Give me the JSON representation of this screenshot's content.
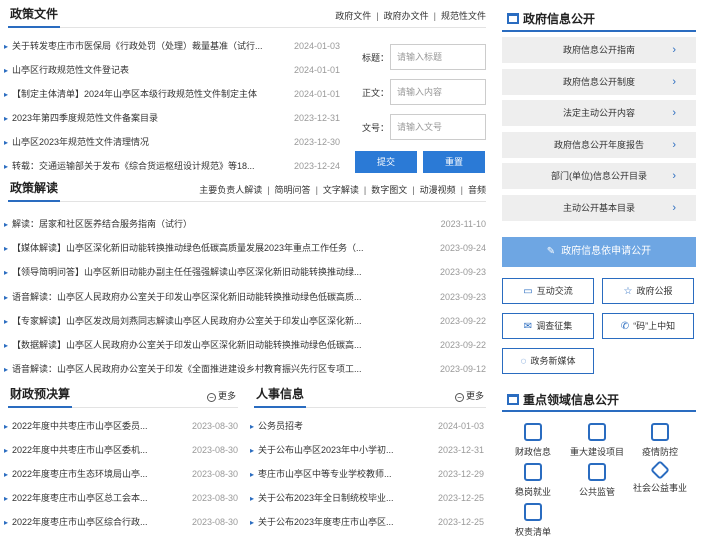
{
  "policy": {
    "title": "政策文件",
    "links": [
      "政府文件",
      "政府办文件",
      "规范性文件"
    ],
    "items": [
      {
        "text": "关于转发枣庄市市医保局《行政处罚（处理）裁量基准（试行...",
        "date": "2024-01-03"
      },
      {
        "text": "山亭区行政规范性文件登记表",
        "date": "2024-01-01"
      },
      {
        "text": "【制定主体清单】2024年山亭区本级行政规范性文件制定主体",
        "date": "2024-01-01"
      },
      {
        "text": "2023年第四季度规范性文件备案目录",
        "date": "2023-12-31"
      },
      {
        "text": "山亭区2023年规范性文件清理情况",
        "date": "2023-12-30"
      },
      {
        "text": "转载：交通运输部关于发布《综合货运枢纽设计规范》等18...",
        "date": "2023-12-24"
      }
    ]
  },
  "search": {
    "title_label": "标题：",
    "title_placeholder": "请输入标题",
    "body_label": "正文：",
    "body_placeholder": "请输入内容",
    "docno_label": "文号：",
    "docno_placeholder": "请输入文号",
    "submit": "提交",
    "reset": "重置"
  },
  "interpret": {
    "title": "政策解读",
    "links": [
      "主要负责人解读",
      "简明问答",
      "文字解读",
      "数字图文",
      "动漫视频",
      "音频"
    ],
    "items": [
      {
        "text": "解读：居家和社区医养结合服务指南（试行）",
        "date": "2023-11-10"
      },
      {
        "text": "【媒体解读】山亭区深化新旧动能转换推动绿色低碳高质量发展2023年重点工作任务（...",
        "date": "2023-09-24"
      },
      {
        "text": "【领导简明问答】山亭区新旧动能办副主任任强强解读山亭区深化新旧动能转换推动绿...",
        "date": "2023-09-23"
      },
      {
        "text": "语音解读：山亭区人民政府办公室关于印发山亭区深化新旧动能转换推动绿色低碳高质...",
        "date": "2023-09-23"
      },
      {
        "text": "【专家解读】山亭区发改局刘燕同志解读山亭区人民政府办公室关于印发山亭区深化新...",
        "date": "2023-09-22"
      },
      {
        "text": "【数据解读】山亭区人民政府办公室关于印发山亭区深化新旧动能转换推动绿色低碳高...",
        "date": "2023-09-22"
      },
      {
        "text": "语音解读：山亭区人民政府办公室关于印发《全面推进建设乡村教育振兴先行区专项工...",
        "date": "2023-09-12"
      }
    ]
  },
  "finance": {
    "title": "财政预决算",
    "more": "更多",
    "items": [
      {
        "text": "2022年度中共枣庄市山亭区委员...",
        "date": "2023-08-30"
      },
      {
        "text": "2022年度中共枣庄市山亭区委机...",
        "date": "2023-08-30"
      },
      {
        "text": "2022年度枣庄市生态环境局山亭...",
        "date": "2023-08-30"
      },
      {
        "text": "2022年度枣庄市山亭区总工会本...",
        "date": "2023-08-30"
      },
      {
        "text": "2022年度枣庄市山亭区综合行政...",
        "date": "2023-08-30"
      }
    ]
  },
  "personnel": {
    "title": "人事信息",
    "more": "更多",
    "items": [
      {
        "text": "公务员招考",
        "date": "2024-01-03"
      },
      {
        "text": "关于公布山亭区2023年中小学初...",
        "date": "2023-12-31"
      },
      {
        "text": "枣庄市山亭区中等专业学校教师...",
        "date": "2023-12-29"
      },
      {
        "text": "关于公布2023年全日制统校毕业...",
        "date": "2023-12-25"
      },
      {
        "text": "关于公布2023年度枣庄市山亭区...",
        "date": "2023-12-25"
      }
    ]
  },
  "gov_info": {
    "title": "政府信息公开",
    "buttons": [
      "政府信息公开指南",
      "政府信息公开制度",
      "法定主动公开内容",
      "政府信息公开年度报告",
      "部门(单位)信息公开目录",
      "主动公开基本目录"
    ],
    "apply": "政府信息依申请公开",
    "grid": [
      {
        "label": "互动交流",
        "icon": "chat-icon"
      },
      {
        "label": "政府公报",
        "icon": "star-icon"
      },
      {
        "label": "调查征集",
        "icon": "mail-icon"
      },
      {
        "label": "“码”上中知",
        "icon": "phone-icon"
      },
      {
        "label": "政务新媒体",
        "icon": "bubble-icon"
      }
    ]
  },
  "key_areas": {
    "title": "重点领域信息公开",
    "items": [
      {
        "label": "财政信息",
        "icon": "wallet-icon"
      },
      {
        "label": "重大建设项目",
        "icon": "folder-icon"
      },
      {
        "label": "疫情防控",
        "icon": "books-icon"
      },
      {
        "label": "稳岗就业",
        "icon": "job-icon"
      },
      {
        "label": "公共监管",
        "icon": "shield-icon"
      },
      {
        "label": "社会公益事业",
        "icon": "diamond-icon"
      },
      {
        "label": "权责清单",
        "icon": "list-icon"
      }
    ]
  },
  "colors": {
    "accent": "#2a6cc0",
    "button_blue": "#2b7ad6",
    "apply_blue": "#6ea6e3",
    "gray_bg": "#eeeeee"
  }
}
